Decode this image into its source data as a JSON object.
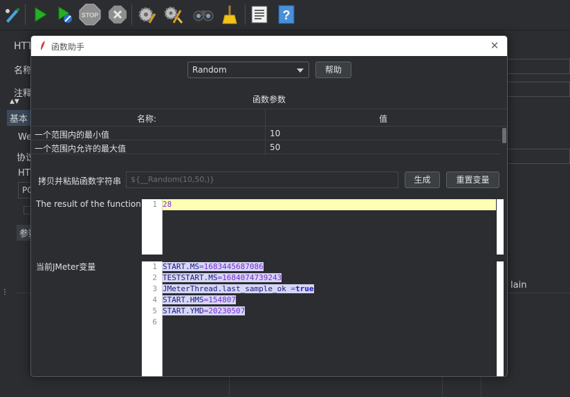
{
  "background": {
    "title_partial": "HTT",
    "name_label": "名称",
    "comment_label": "注释",
    "tab_basic": "基本",
    "web_partial": "We",
    "protocol_partial": "协议",
    "http_partial": "HTT",
    "method_partial": "PO",
    "params_partial": "参数",
    "plain_partial": "lain"
  },
  "dialog": {
    "title": "函数助手",
    "function_select": "Random",
    "help_button": "帮助",
    "section_label": "函数参数",
    "table": {
      "headers": [
        "名称:",
        "值"
      ],
      "rows": [
        {
          "name": "一个范围内的最小值",
          "value": "10"
        },
        {
          "name": "一个范围内允许的最大值",
          "value": "50"
        }
      ]
    },
    "copy_label": "拷贝并粘贴函数字符串",
    "function_string": "${__Random(10,50,)}",
    "generate_button": "生成",
    "reset_button": "重置变量",
    "result_label": "The result of the function is",
    "result_lines": [
      "28"
    ],
    "vars_label": "当前JMeter变量",
    "vars": [
      {
        "key": "START.MS",
        "eq": "=",
        "value": "1683445687086"
      },
      {
        "key": "TESTSTART.MS",
        "eq": "=",
        "value": "1684074739243"
      },
      {
        "key": "JMeterThread.last_sample_ok",
        "eq": " =",
        "value": "true"
      },
      {
        "key": "START.HMS",
        "eq": "=",
        "value": "154807"
      },
      {
        "key": "START.YMD",
        "eq": "=",
        "value": "20230507"
      }
    ],
    "line_numbers": [
      "1",
      "2",
      "3",
      "4",
      "5",
      "6"
    ]
  },
  "icons": [
    "pencil-icon",
    "start-icon",
    "start-no-pause-icon",
    "stop-icon",
    "shutdown-icon",
    "gear-icon",
    "gear-broom-icon",
    "binoculars-icon",
    "broom-icon",
    "function-helper-icon",
    "help-icon"
  ]
}
